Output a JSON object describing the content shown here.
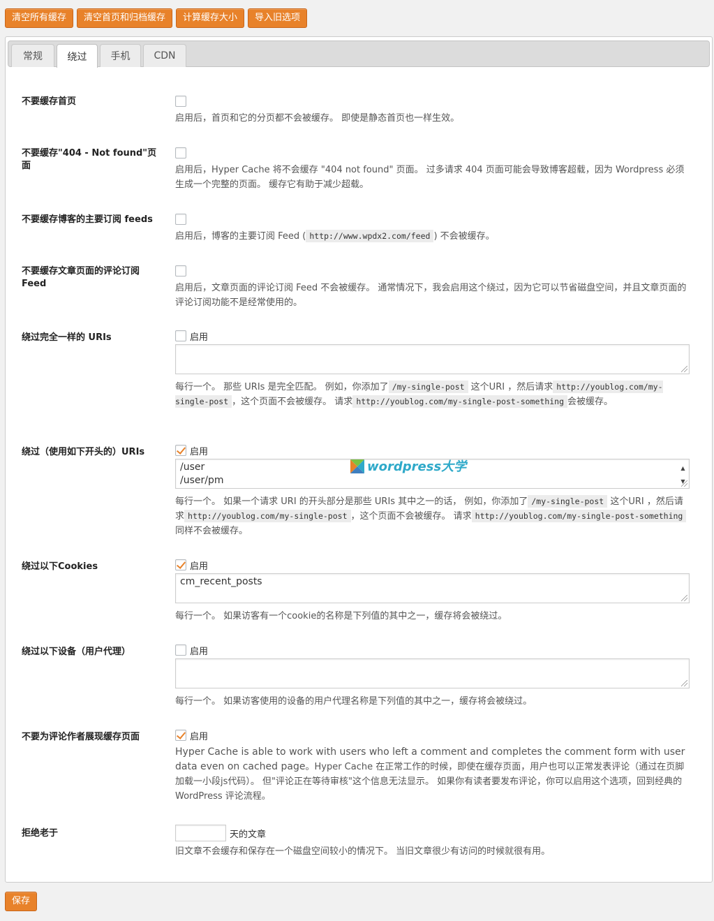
{
  "toolbar": {
    "buttons": [
      "清空所有缓存",
      "清空首页和归档缓存",
      "计算缓存大小",
      "导入旧选项"
    ]
  },
  "tabs": [
    "常规",
    "绕过",
    "手机",
    "CDN"
  ],
  "active_tab": "绕过",
  "settings": {
    "home": {
      "label": "不要缓存首页",
      "desc": "启用后，首页和它的分页都不会被缓存。 即使是静态首页也一样生效。"
    },
    "notfound": {
      "label": "不要缓存\"404 - Not found\"页面",
      "desc": "启用后，Hyper Cache 将不会缓存 \"404 not found\" 页面。 过多请求 404 页面可能会导致博客超载，因为 Wordpress 必须生成一个完整的页面。 缓存它有助于减少超载。"
    },
    "feeds": {
      "label": "不要缓存博客的主要订阅 feeds",
      "desc_pre": "启用后，博客的主要订阅 Feed (",
      "desc_code": "http://www.wpdx2.com/feed",
      "desc_post": ") 不会被缓存。"
    },
    "comment_feeds": {
      "label": "不要缓存文章页面的评论订阅 Feed",
      "desc": "启用后，文章页面的评论订阅 Feed 不会被缓存。 通常情况下，我会启用这个绕过，因为它可以节省磁盘空间，并且文章页面的评论订阅功能不是经常使用的。"
    },
    "exact_uris": {
      "label": "绕过完全一样的 URIs",
      "enable_label": "启用",
      "checked": false,
      "value": "",
      "desc_1": "每行一个。 那些 URIs 是完全匹配。 例如，你添加了",
      "code_1": "/my-single-post",
      "desc_2": " 这个URI ，然后请求",
      "code_2": "http://youblog.com/my-single-post",
      "desc_3": "，这个页面不会被缓存。 请求",
      "code_3": "http://youblog.com/my-single-post-something",
      "desc_4": "会被缓存。"
    },
    "prefix_uris": {
      "label": "绕过（使用如下开头的）URIs",
      "enable_label": "启用",
      "checked": true,
      "lines": [
        "/user",
        "/user/pm"
      ],
      "watermark": "wordpress大学",
      "desc_1": "每行一个。 如果一个请求 URI 的开头部分是那些 URIs 其中之一的话， 例如，你添加了",
      "code_1": "/my-single-post",
      "desc_2": " 这个URI ，然后请求",
      "code_2": "http://youblog.com/my-single-post",
      "desc_3": "，这个页面不会被缓存。 请求",
      "code_3": "http://youblog.com/my-single-post-something",
      "desc_4": "同样不会被缓存。"
    },
    "cookies": {
      "label": "绕过以下Cookies",
      "enable_label": "启用",
      "checked": true,
      "value": "cm_recent_posts",
      "desc": "每行一个。 如果访客有一个cookie的名称是下列值的其中之一，缓存将会被绕过。"
    },
    "agents": {
      "label": "绕过以下设备（用户代理）",
      "enable_label": "启用",
      "checked": false,
      "value": "",
      "desc": "每行一个。 如果访客使用的设备的用户代理名称是下列值的其中之一，缓存将会被绕过。"
    },
    "commenters": {
      "label": "不要为评论作者展现缓存页面",
      "enable_label": "启用",
      "checked": true,
      "desc_en": "Hyper Cache is able to work with users who left a comment and completes the comment form with user data even on cached page",
      "desc_cn": "。Hyper Cache 在正常工作的时候，即使在缓存页面，用户也可以正常发表评论（通过在页脚加载一小段js代码）。 但\"评论正在等待审核\"这个信息无法显示。 如果你有读者要发布评论，你可以启用这个选项，回到经典的 WordPress 评论流程。"
    },
    "old_posts": {
      "label": "拒绝老于",
      "suffix": "天的文章",
      "value": "",
      "desc": "旧文章不会缓存和保存在一个磁盘空间较小的情况下。 当旧文章很少有访问的时候就很有用。"
    }
  },
  "save_label": "保存",
  "colors": {
    "accent": "#e8822a",
    "accent_border": "#c9661a",
    "watermark": "#2ea9c9"
  }
}
